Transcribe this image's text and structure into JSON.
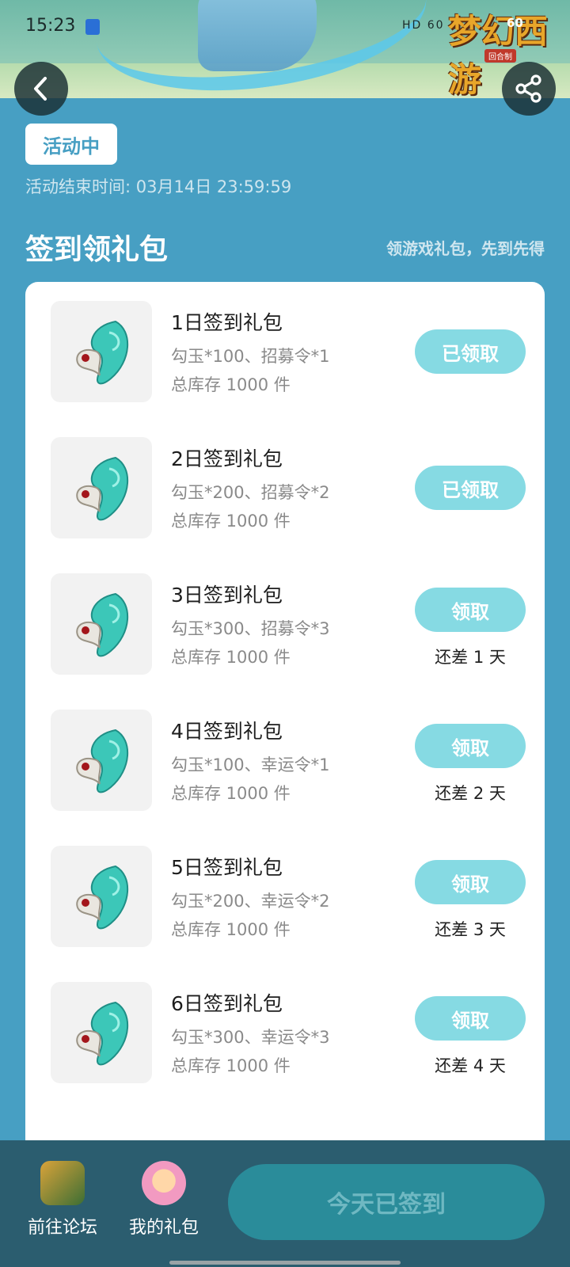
{
  "status_bar": {
    "time": "15:23",
    "icons": "HD 60"
  },
  "banner": {
    "logo_text": "梦幻西游",
    "logo_badge": "60",
    "logo_sub": "回合制"
  },
  "header": {
    "tag": "活动中",
    "end_time": "活动结束时间: 03月14日 23:59:59",
    "section_title": "签到领礼包",
    "section_subtitle": "领游戏礼包，先到先得"
  },
  "gifts": [
    {
      "title": "1日签到礼包",
      "desc": "勾玉*100、招募令*1",
      "stock": "总库存 1000 件",
      "button": "已领取",
      "status": "claimed",
      "remain": ""
    },
    {
      "title": "2日签到礼包",
      "desc": "勾玉*200、招募令*2",
      "stock": "总库存 1000 件",
      "button": "已领取",
      "status": "claimed",
      "remain": ""
    },
    {
      "title": "3日签到礼包",
      "desc": "勾玉*300、招募令*3",
      "stock": "总库存 1000 件",
      "button": "领取",
      "status": "pending",
      "remain": "还差 1 天"
    },
    {
      "title": "4日签到礼包",
      "desc": "勾玉*100、幸运令*1",
      "stock": "总库存 1000 件",
      "button": "领取",
      "status": "pending",
      "remain": "还差 2 天"
    },
    {
      "title": "5日签到礼包",
      "desc": "勾玉*200、幸运令*2",
      "stock": "总库存 1000 件",
      "button": "领取",
      "status": "pending",
      "remain": "还差 3 天"
    },
    {
      "title": "6日签到礼包",
      "desc": "勾玉*300、幸运令*3",
      "stock": "总库存 1000 件",
      "button": "领取",
      "status": "pending",
      "remain": "还差 4 天"
    }
  ],
  "bottom_bar": {
    "forum_label": "前往论坛",
    "my_gifts_label": "我的礼包",
    "checkin_label": "今天已签到"
  },
  "colors": {
    "page_bg": "#479fc3",
    "button_light": "#86dae3",
    "bottom_bar": "#2b5d6f",
    "checkin_button": "#2a8c9a"
  }
}
